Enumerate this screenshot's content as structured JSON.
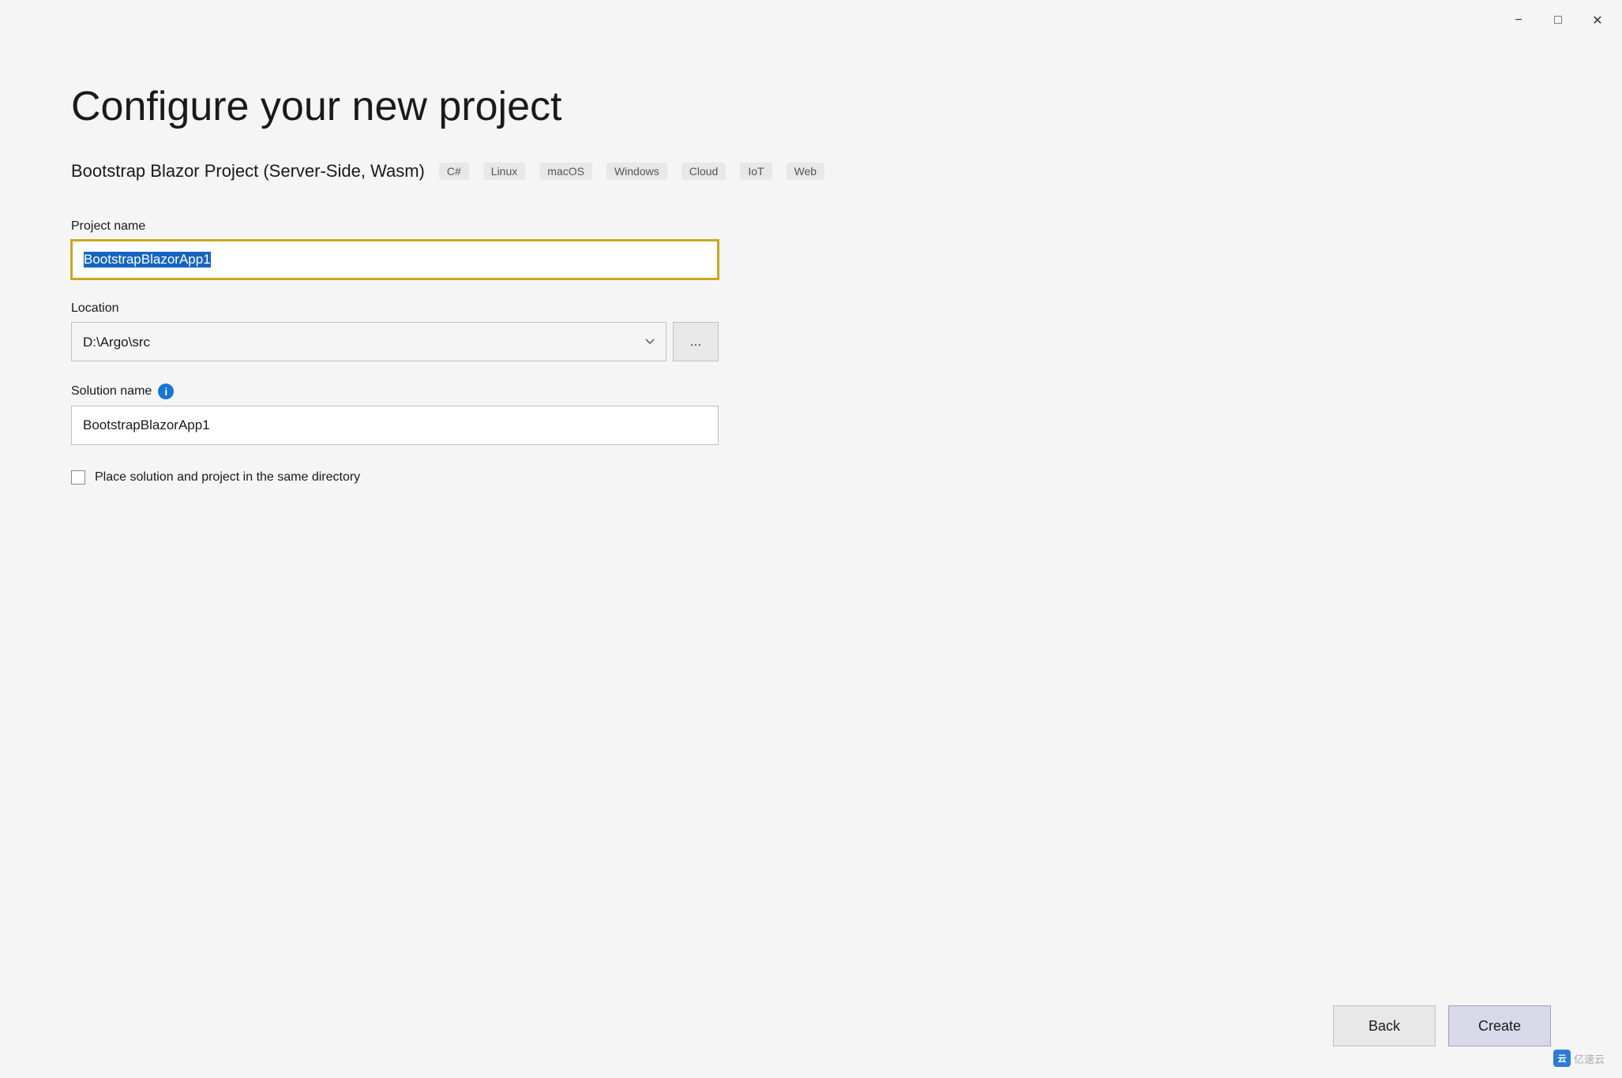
{
  "window": {
    "title": "Configure your new project"
  },
  "titlebar": {
    "minimize_label": "−",
    "maximize_label": "□",
    "close_label": "✕"
  },
  "page": {
    "title": "Configure your new project",
    "project_type": {
      "name": "Bootstrap Blazor Project (Server-Side, Wasm)",
      "tags": [
        "C#",
        "Linux",
        "macOS",
        "Windows",
        "Cloud",
        "IoT",
        "Web"
      ]
    },
    "fields": {
      "project_name": {
        "label": "Project name",
        "value": "BootstrapBlazorApp1",
        "placeholder": ""
      },
      "location": {
        "label": "Location",
        "value": "D:\\Argo\\src",
        "browse_label": "..."
      },
      "solution_name": {
        "label": "Solution name",
        "has_info": true,
        "value": "BootstrapBlazorApp1",
        "placeholder": ""
      },
      "same_directory": {
        "label": "Place solution and project in the same directory",
        "checked": false
      }
    },
    "buttons": {
      "back": "Back",
      "create": "Create"
    },
    "watermark": "亿速云"
  }
}
